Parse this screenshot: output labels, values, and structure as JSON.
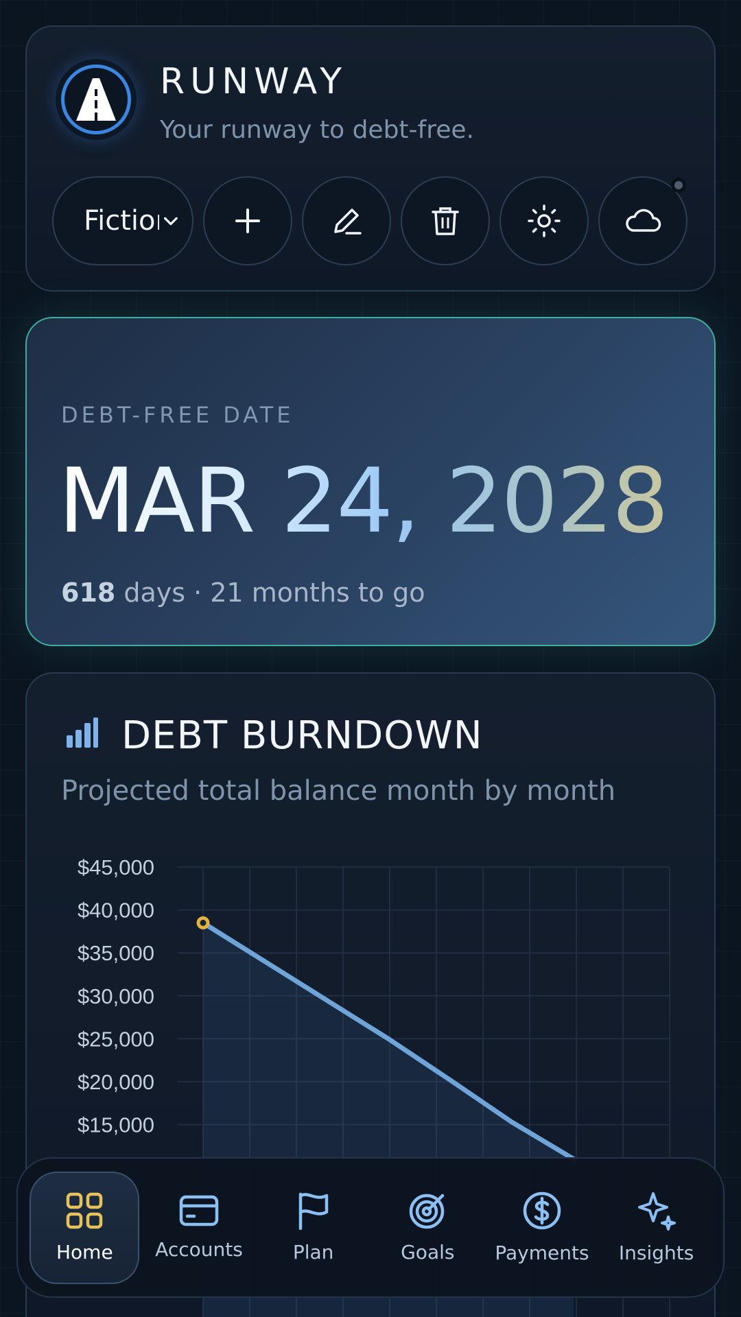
{
  "header": {
    "title": "RUNWAY",
    "tagline": "Your runway to debt-free.",
    "profile_select": "Fiction",
    "buttons": [
      "plus-icon",
      "pencil-icon",
      "trash-icon",
      "sun-icon",
      "cloud-icon"
    ]
  },
  "debt_free": {
    "label": "DEBT-FREE DATE",
    "date": "MAR 24, 2028",
    "days": "618",
    "days_suffix": "days · 21 months to go"
  },
  "burndown": {
    "title": "DEBT BURNDOWN",
    "subtitle": "Projected total balance month by month",
    "accent": "#6ea4d8"
  },
  "chart_data": {
    "type": "area",
    "y_ticks": [
      "$45,000",
      "$40,000",
      "$35,000",
      "$30,000",
      "$25,000",
      "$20,000",
      "$15,000"
    ],
    "ylim": [
      10000,
      45000
    ],
    "x_count": 11,
    "series": [
      {
        "values": [
          38500,
          34000,
          29500,
          25000,
          20200,
          15300,
          11000
        ]
      }
    ],
    "start_marker_color": "#e0b341"
  },
  "nav": {
    "items": [
      {
        "label": "Home",
        "icon": "grid-icon",
        "active": true
      },
      {
        "label": "Accounts",
        "icon": "card-icon"
      },
      {
        "label": "Plan",
        "icon": "flag-icon"
      },
      {
        "label": "Goals",
        "icon": "target-icon"
      },
      {
        "label": "Payments",
        "icon": "dollar-icon"
      },
      {
        "label": "Insights",
        "icon": "sparkle-icon"
      }
    ],
    "active_color": "#e6c35a",
    "icon_color": "#8cc0f2"
  }
}
